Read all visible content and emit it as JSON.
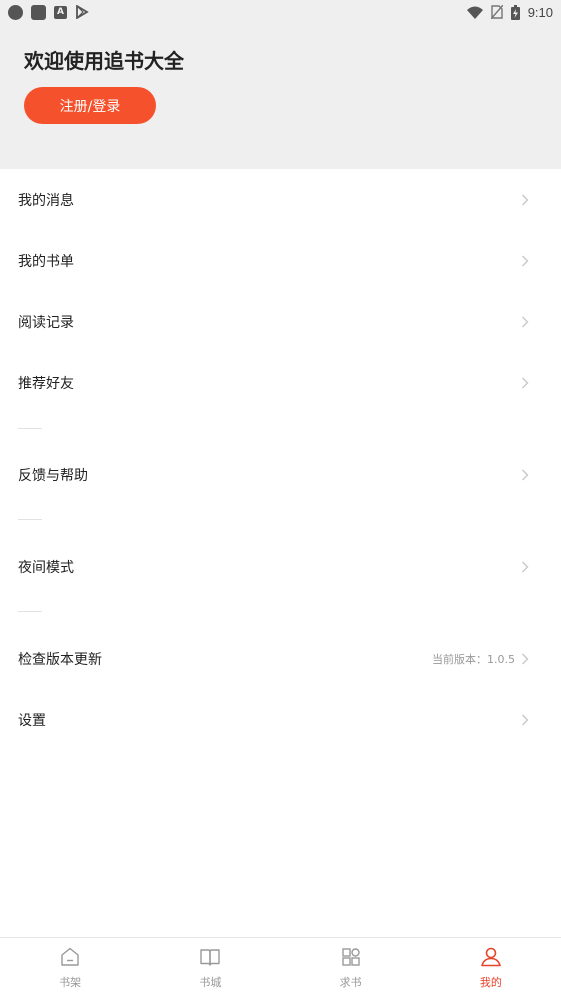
{
  "status_bar": {
    "time": "9:10",
    "left_icons": [
      "circle-icon",
      "square-icon",
      "a-icon",
      "play-store-icon"
    ],
    "right_icons": [
      "wifi-icon",
      "no-sim-icon",
      "battery-charging-icon"
    ]
  },
  "header": {
    "welcome": "欢迎使用追书大全",
    "login_label": "注册/登录",
    "login_color": "#f4512c"
  },
  "menu": {
    "items": [
      {
        "label": "我的消息",
        "extra": ""
      },
      {
        "label": "我的书单",
        "extra": ""
      },
      {
        "label": "阅读记录",
        "extra": ""
      },
      {
        "label": "推荐好友",
        "extra": ""
      },
      {
        "label": "反馈与帮助",
        "extra": ""
      },
      {
        "label": "夜间模式",
        "extra": ""
      },
      {
        "label": "检查版本更新",
        "extra": "当前版本：1.0.5"
      },
      {
        "label": "设置",
        "extra": ""
      }
    ]
  },
  "tabbar": {
    "tabs": [
      {
        "label": "书架",
        "icon": "home-icon",
        "active": false
      },
      {
        "label": "书城",
        "icon": "book-icon",
        "active": false
      },
      {
        "label": "求书",
        "icon": "grid-icon",
        "active": false
      },
      {
        "label": "我的",
        "icon": "user-icon",
        "active": true
      }
    ],
    "active_color": "#e8442a"
  }
}
